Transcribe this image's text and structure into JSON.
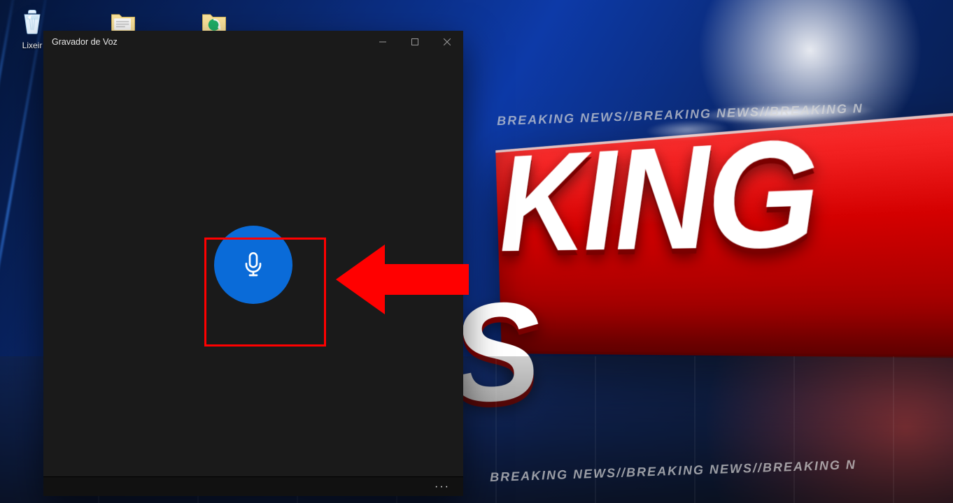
{
  "desktop": {
    "wallpaper": {
      "ticker_text": "BREAKING NEWS//BREAKING NEWS//BREAKING N",
      "headline_fragment_1": "KING",
      "headline_fragment_2": "S"
    },
    "icons": [
      {
        "name": "recycle-bin",
        "label": "Lixeir"
      },
      {
        "name": "folder-1",
        "label": ""
      },
      {
        "name": "folder-2",
        "label": ""
      }
    ]
  },
  "app": {
    "title": "Gravador de Voz",
    "record_button": {
      "icon": "microphone-icon"
    },
    "more_button": {
      "glyph": "···"
    }
  },
  "annotation": {
    "highlight_color": "#ff0000",
    "arrow_color": "#ff0000"
  }
}
